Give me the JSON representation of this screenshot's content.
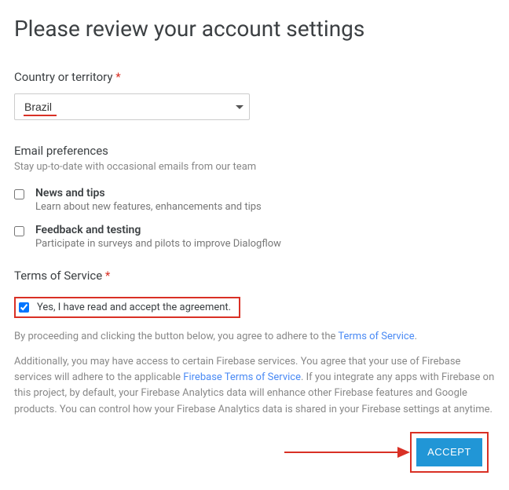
{
  "title": "Please review your account settings",
  "country": {
    "label": "Country or territory",
    "required": "*",
    "value": "Brazil"
  },
  "email": {
    "heading": "Email preferences",
    "sub": "Stay up-to-date with occasional emails from our team",
    "prefs": [
      {
        "title": "News and tips",
        "desc": "Learn about new features, enhancements and tips"
      },
      {
        "title": "Feedback and testing",
        "desc": "Participate in surveys and pilots to improve Dialogflow"
      }
    ]
  },
  "tos": {
    "heading": "Terms of Service",
    "required": "*",
    "agree": "Yes, I have read and accept the agreement.",
    "para1_a": "By proceeding and clicking the button below, you agree to adhere to the ",
    "para1_link": "Terms of Service",
    "para1_b": ".",
    "para2_a": "Additionally, you may have access to certain Firebase services. You agree that your use of Firebase services will adhere to the applicable ",
    "para2_link": "Firebase Terms of Service",
    "para2_b": ". If you integrate any apps with Firebase on this project, by default, your Firebase Analytics data will enhance other Firebase features and Google products. You can control how your Firebase Analytics data is shared in your Firebase settings at anytime."
  },
  "accept": "ACCEPT"
}
